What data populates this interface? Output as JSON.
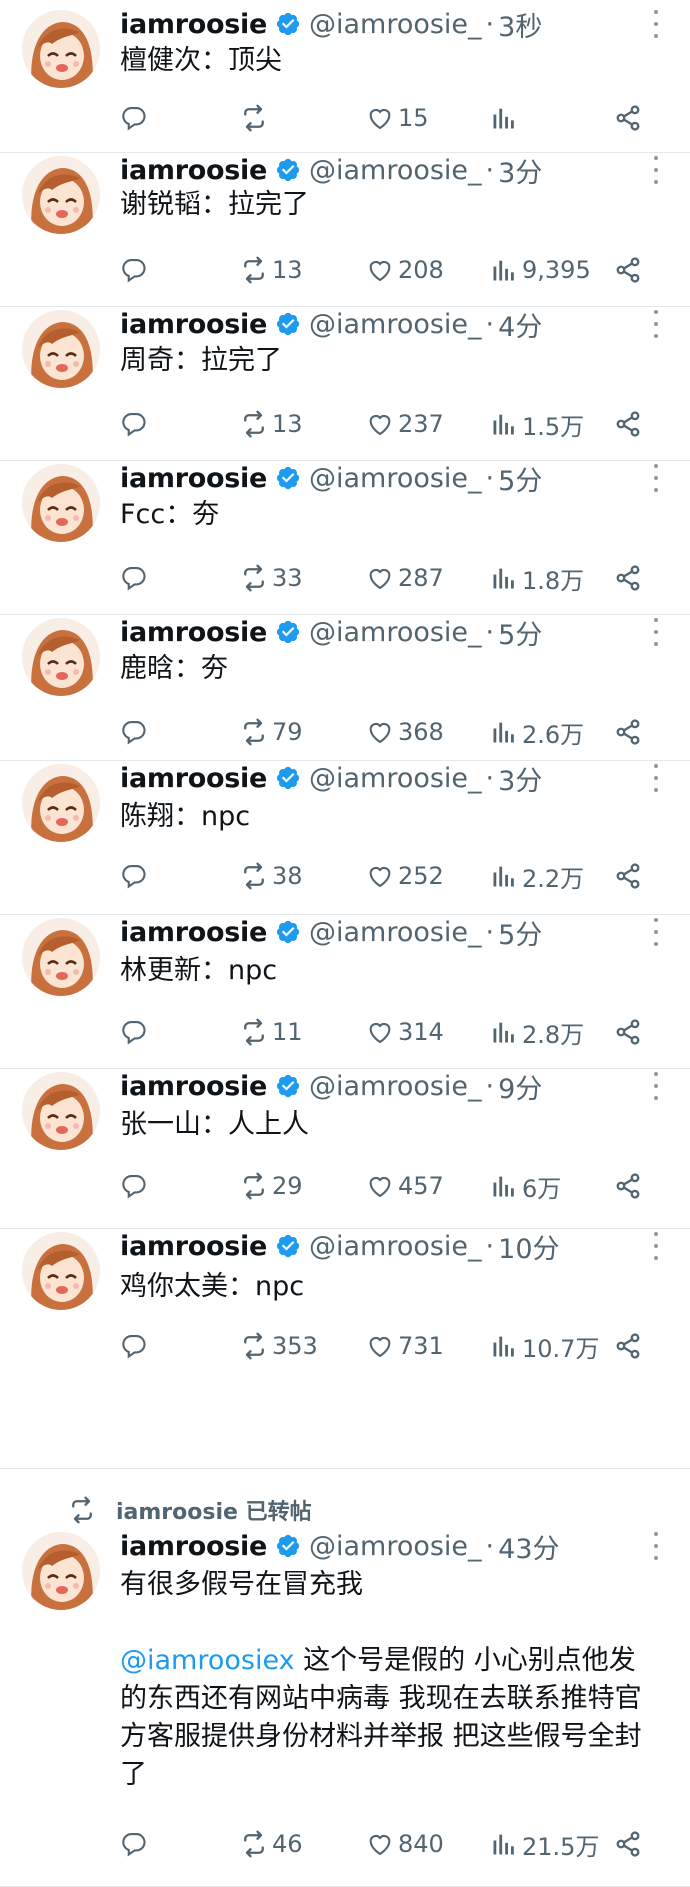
{
  "feed": {
    "retweet_banner": "iamroosie 已转帖",
    "tweets": [
      {
        "name": "iamroosie",
        "handle": "@iamroosie_",
        "dot": "·",
        "time": "3秒",
        "text": "檀健次：顶尖",
        "reply": "",
        "retweets": "",
        "likes": "15",
        "views": ""
      },
      {
        "name": "iamroosie",
        "handle": "@iamroosie_",
        "dot": "·",
        "time": "3分",
        "text": "谢锐韬：拉完了",
        "reply": "",
        "retweets": "13",
        "likes": "208",
        "views": "9,395"
      },
      {
        "name": "iamroosie",
        "handle": "@iamroosie_",
        "dot": "·",
        "time": "4分",
        "text": "周奇：拉完了",
        "reply": "",
        "retweets": "13",
        "likes": "237",
        "views": "1.5万"
      },
      {
        "name": "iamroosie",
        "handle": "@iamroosie_",
        "dot": "·",
        "time": "5分",
        "text": "Fcc：夯",
        "reply": "",
        "retweets": "33",
        "likes": "287",
        "views": "1.8万"
      },
      {
        "name": "iamroosie",
        "handle": "@iamroosie_",
        "dot": "·",
        "time": "5分",
        "text": "鹿晗：夯",
        "reply": "",
        "retweets": "79",
        "likes": "368",
        "views": "2.6万"
      },
      {
        "name": "iamroosie",
        "handle": "@iamroosie_",
        "dot": "·",
        "time": "3分",
        "text": "陈翔：npc",
        "reply": "",
        "retweets": "38",
        "likes": "252",
        "views": "2.2万"
      },
      {
        "name": "iamroosie",
        "handle": "@iamroosie_",
        "dot": "·",
        "time": "5分",
        "text": "林更新：npc",
        "reply": "",
        "retweets": "11",
        "likes": "314",
        "views": "2.8万"
      },
      {
        "name": "iamroosie",
        "handle": "@iamroosie_",
        "dot": "·",
        "time": "9分",
        "text": "张一山：人上人",
        "reply": "",
        "retweets": "29",
        "likes": "457",
        "views": "6万"
      },
      {
        "name": "iamroosie",
        "handle": "@iamroosie_",
        "dot": "·",
        "time": "10分",
        "text": "鸡你太美：npc",
        "reply": "",
        "retweets": "353",
        "likes": "731",
        "views": "10.7万"
      },
      {
        "name": "iamroosie",
        "handle": "@iamroosie_",
        "dot": "·",
        "time": "43分",
        "text": "有很多假号在冒充我",
        "mention": "@iamroosiex",
        "text2": " 这个号是假的 小心别点他发的东西还有网站中病毒 我现在去联系推特官方客服提供身份材料并举报 把这些假号全封了",
        "reply": "",
        "retweets": "46",
        "likes": "840",
        "views": "21.5万"
      }
    ]
  },
  "colors": {
    "accent": "#1d9bf0",
    "text": "#0f1419",
    "muted": "#536471",
    "divider": "#e6e9ec"
  },
  "icons": [
    "verified-icon",
    "more-icon",
    "reply-icon",
    "retweet-icon",
    "like-icon",
    "views-icon",
    "share-icon",
    "avatar-image"
  ]
}
